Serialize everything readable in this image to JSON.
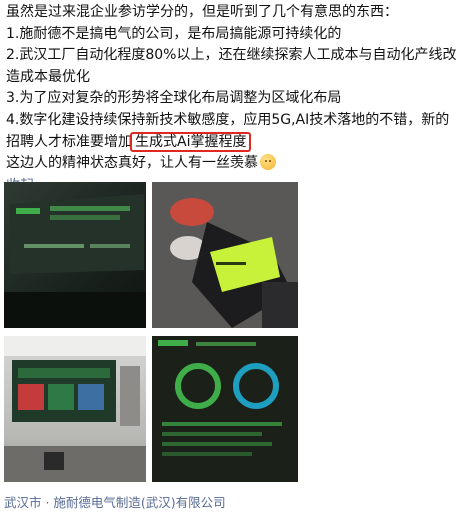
{
  "post": {
    "lines": [
      "虽然是过来混企业参访学分的，但是听到了几个有意思的东西：",
      "1.施耐德不是搞电气的公司，是布局搞能源可持续化的",
      "2.武汉工厂自动化程度80%以上，还在继续探索人工成本与自动化产线改造成本最优化",
      "3.为了应对复杂的形势将全球化布局调整为区域化布局"
    ],
    "line5_before": "4.数字化建设持续保持新技术敏感度，应用5G,AI技术落地的不错，新的招聘人才标准要增加",
    "line5_highlight": "生成式Ai掌握程度",
    "last_line": "这边人的精神状态真好，让人有一丝羡慕",
    "collapse_label": "收起",
    "location": "武汉市 · 施耐德电气制造(武汉)有限公司"
  },
  "colors": {
    "link": "#576b95",
    "highlight_box": "#e0281e"
  }
}
